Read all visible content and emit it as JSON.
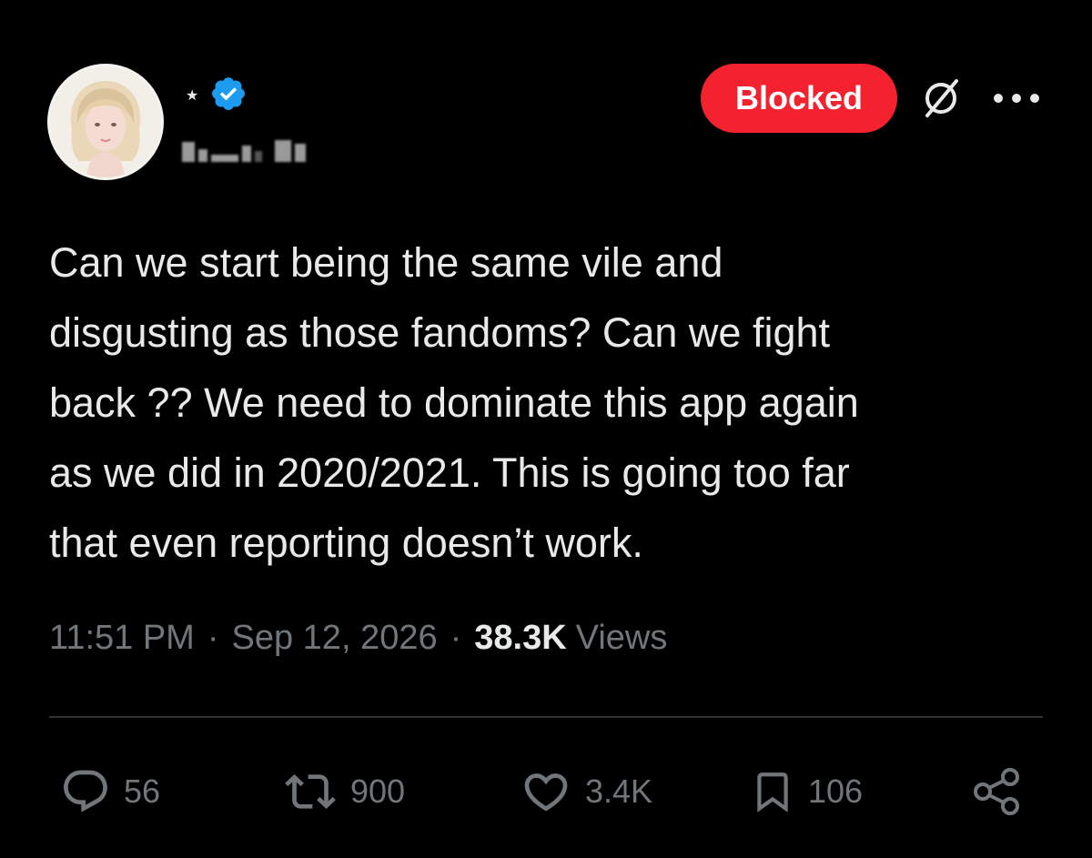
{
  "author": {
    "display_name_symbol": "★",
    "verified_icon": "verified-badge-icon",
    "handle_obscured": true
  },
  "header": {
    "blocked_label": "Blocked",
    "blocked_color": "#f4212e",
    "block_icon": "blocked-slash-icon",
    "more_icon": "more-dots-icon"
  },
  "tweet": {
    "lines": [
      "Can we start being the same vile and",
      "disgusting as those fandoms? Can we fight",
      "back ?? We need to dominate this app again",
      "as we did in 2020/2021. This is going too far",
      "that even reporting doesn’t work."
    ]
  },
  "meta": {
    "time": "11:51 PM",
    "separator": "·",
    "date": "Sep 12, 2026",
    "views_count": "38.3K",
    "views_label": "Views"
  },
  "actions": {
    "replies": "56",
    "retweets": "900",
    "likes": "3.4K",
    "bookmarks": "106",
    "reply_icon": "reply-bubble-icon",
    "retweet_icon": "retweet-icon",
    "like_icon": "heart-icon",
    "bookmark_icon": "bookmark-icon",
    "share_icon": "share-icon"
  },
  "colors": {
    "background": "#000000",
    "text": "#e7e9ea",
    "muted": "#71767b",
    "verified": "#1d9bf0"
  }
}
